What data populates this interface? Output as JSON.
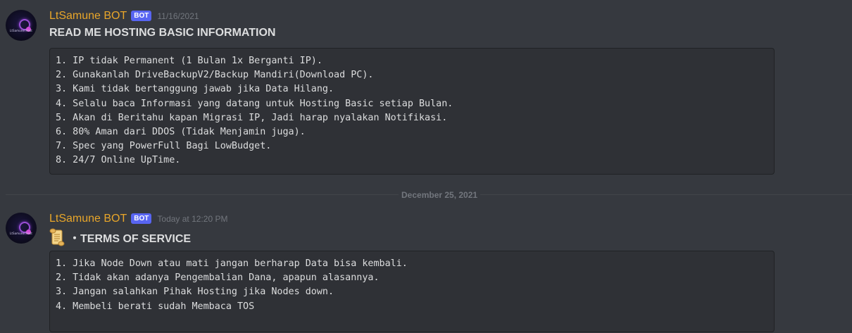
{
  "messages": [
    {
      "author": "LtSamune BOT",
      "badge": "BOT",
      "timestamp": "11/16/2021",
      "avatar_text": "LtSamune Host",
      "title": "READ ME HOSTING BASIC INFORMATION",
      "code_lines": [
        "1. IP tidak Permanent (1 Bulan 1x Berganti IP).",
        "2. Gunakanlah DriveBackupV2/Backup Mandiri(Download PC).",
        "3. Kami tidak bertanggung jawab jika Data Hilang.",
        "4. Selalu baca Informasi yang datang untuk Hosting Basic setiap Bulan.",
        "5. Akan di Beritahu kapan Migrasi IP, Jadi harap nyalakan Notifikasi.",
        "6. 80% Aman dari DDOS (Tidak Menjamin juga).",
        "7. Spec yang PowerFull Bagi LowBudget.",
        "8. 24/7 Online UpTime."
      ]
    },
    {
      "author": "LtSamune BOT",
      "badge": "BOT",
      "timestamp": "Today at 12:20 PM",
      "avatar_text": "LtSamune Host",
      "title_icon": "scroll-icon",
      "title": "・TERMS OF SERVICE",
      "code_lines": [
        "1. Jika Node Down atau mati jangan berharap Data bisa kembali.",
        "2. Tidak akan adanya Pengembalian Dana, apapun alasannya.",
        "3. Jangan salahkan Pihak Hosting jika Nodes down.",
        "4. Membeli berati sudah Membaca TOS"
      ]
    }
  ],
  "date_divider": "December 25, 2021",
  "colors": {
    "background": "#36393f",
    "author": "#e8a62a",
    "bot_badge": "#5865f2",
    "code_background": "#2f3136",
    "text": "#dcddde",
    "muted": "#72767d"
  }
}
